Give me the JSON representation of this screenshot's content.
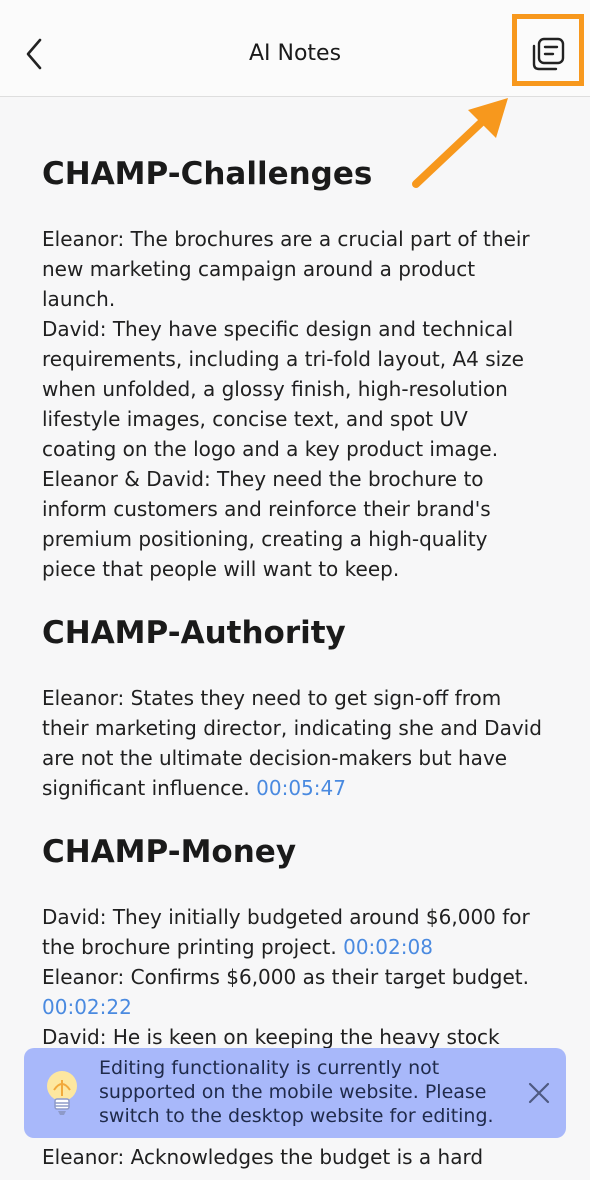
{
  "header": {
    "title": "AI Notes",
    "back_icon": "chevron-left-icon",
    "notes_icon": "notes-copy-icon"
  },
  "annotation": {
    "highlight_color": "#f7981d"
  },
  "sections": [
    {
      "heading": "CHAMP-Challenges",
      "lines": [
        "Eleanor: The brochures are a crucial part of their",
        "new marketing campaign around a product",
        "launch.",
        "David: They have specific design and technical",
        "requirements, including a tri-fold layout, A4 size",
        "when unfolded, a glossy finish, high-resolution",
        "lifestyle images, concise text, and spot UV",
        "coating on the logo and a key product image.",
        "Eleanor & David: They need the brochure to",
        "inform customers and reinforce their brand's",
        "premium positioning, creating a high-quality",
        "piece that people will want to keep."
      ]
    },
    {
      "heading": "CHAMP-Authority",
      "lines": [
        "Eleanor: States they need to get sign-off from",
        "their marketing director, indicating she and David",
        "are not the ultimate decision-makers but have",
        "significant influence. "
      ],
      "timestamps": [
        "00:05:47"
      ]
    },
    {
      "heading": "CHAMP-Money",
      "lines": [
        "David: They initially budgeted around $6,000 for",
        "the brochure printing project. ",
        "Eleanor: Confirms $6,000 as their target budget.",
        "",
        "David: He is keen on keeping the heavy stock",
        "Eleanor: Acknowledges the budget is a hard"
      ],
      "timestamps": [
        "00:02:08",
        "00:02:22"
      ]
    }
  ],
  "toast": {
    "lines": [
      "Editing functionality is currently not",
      "supported on the mobile website. Please",
      "switch to the desktop website for editing."
    ],
    "icon": "lightbulb-icon",
    "close_icon": "close-icon",
    "background": "#a8b8fa"
  },
  "colors": {
    "timestamp": "#4a8ae0",
    "background": "#f7f7f8"
  }
}
